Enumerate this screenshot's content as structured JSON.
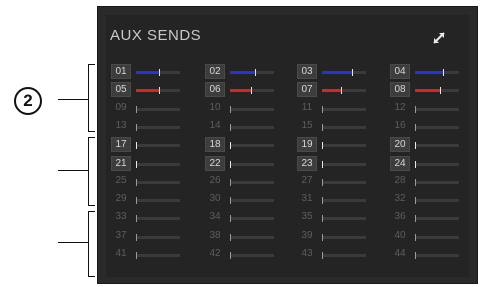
{
  "callout": {
    "number": "2"
  },
  "panel": {
    "title": "AUX SENDS",
    "expand_icon": "expand-arrows-icon"
  },
  "colors": {
    "blue": "#2233dd",
    "red": "#dd2222",
    "track": "#3a3a3a"
  },
  "rows": [
    [
      "01",
      "02",
      "03",
      "04"
    ],
    [
      "05",
      "06",
      "07",
      "08"
    ],
    [
      "09",
      "10",
      "11",
      "12"
    ],
    [
      "13",
      "14",
      "15",
      "16"
    ],
    [
      "17",
      "18",
      "19",
      "20"
    ],
    [
      "21",
      "22",
      "23",
      "24"
    ],
    [
      "25",
      "26",
      "27",
      "28"
    ],
    [
      "29",
      "30",
      "31",
      "32"
    ],
    [
      "33",
      "34",
      "35",
      "36"
    ],
    [
      "37",
      "38",
      "39",
      "40"
    ],
    [
      "41",
      "42",
      "43",
      "44"
    ]
  ],
  "channels": {
    "01": {
      "active": true,
      "color": "blue",
      "level": 0.55
    },
    "02": {
      "active": true,
      "color": "blue",
      "level": 0.6
    },
    "03": {
      "active": true,
      "color": "blue",
      "level": 0.7
    },
    "04": {
      "active": true,
      "color": "blue",
      "level": 0.65
    },
    "05": {
      "active": true,
      "color": "red",
      "level": 0.55
    },
    "06": {
      "active": true,
      "color": "red",
      "level": 0.5
    },
    "07": {
      "active": true,
      "color": "red",
      "level": 0.45
    },
    "08": {
      "active": true,
      "color": "red",
      "level": 0.6
    },
    "17": {
      "active": true,
      "color": "none",
      "level": 0.0
    },
    "18": {
      "active": true,
      "color": "none",
      "level": 0.0
    },
    "19": {
      "active": true,
      "color": "none",
      "level": 0.0
    },
    "20": {
      "active": true,
      "color": "none",
      "level": 0.0
    },
    "21": {
      "active": true,
      "color": "none",
      "level": 0.0
    },
    "22": {
      "active": true,
      "color": "red",
      "level": 0.03
    },
    "23": {
      "active": true,
      "color": "red",
      "level": 0.03
    },
    "24": {
      "active": true,
      "color": "none",
      "level": 0.0
    }
  }
}
